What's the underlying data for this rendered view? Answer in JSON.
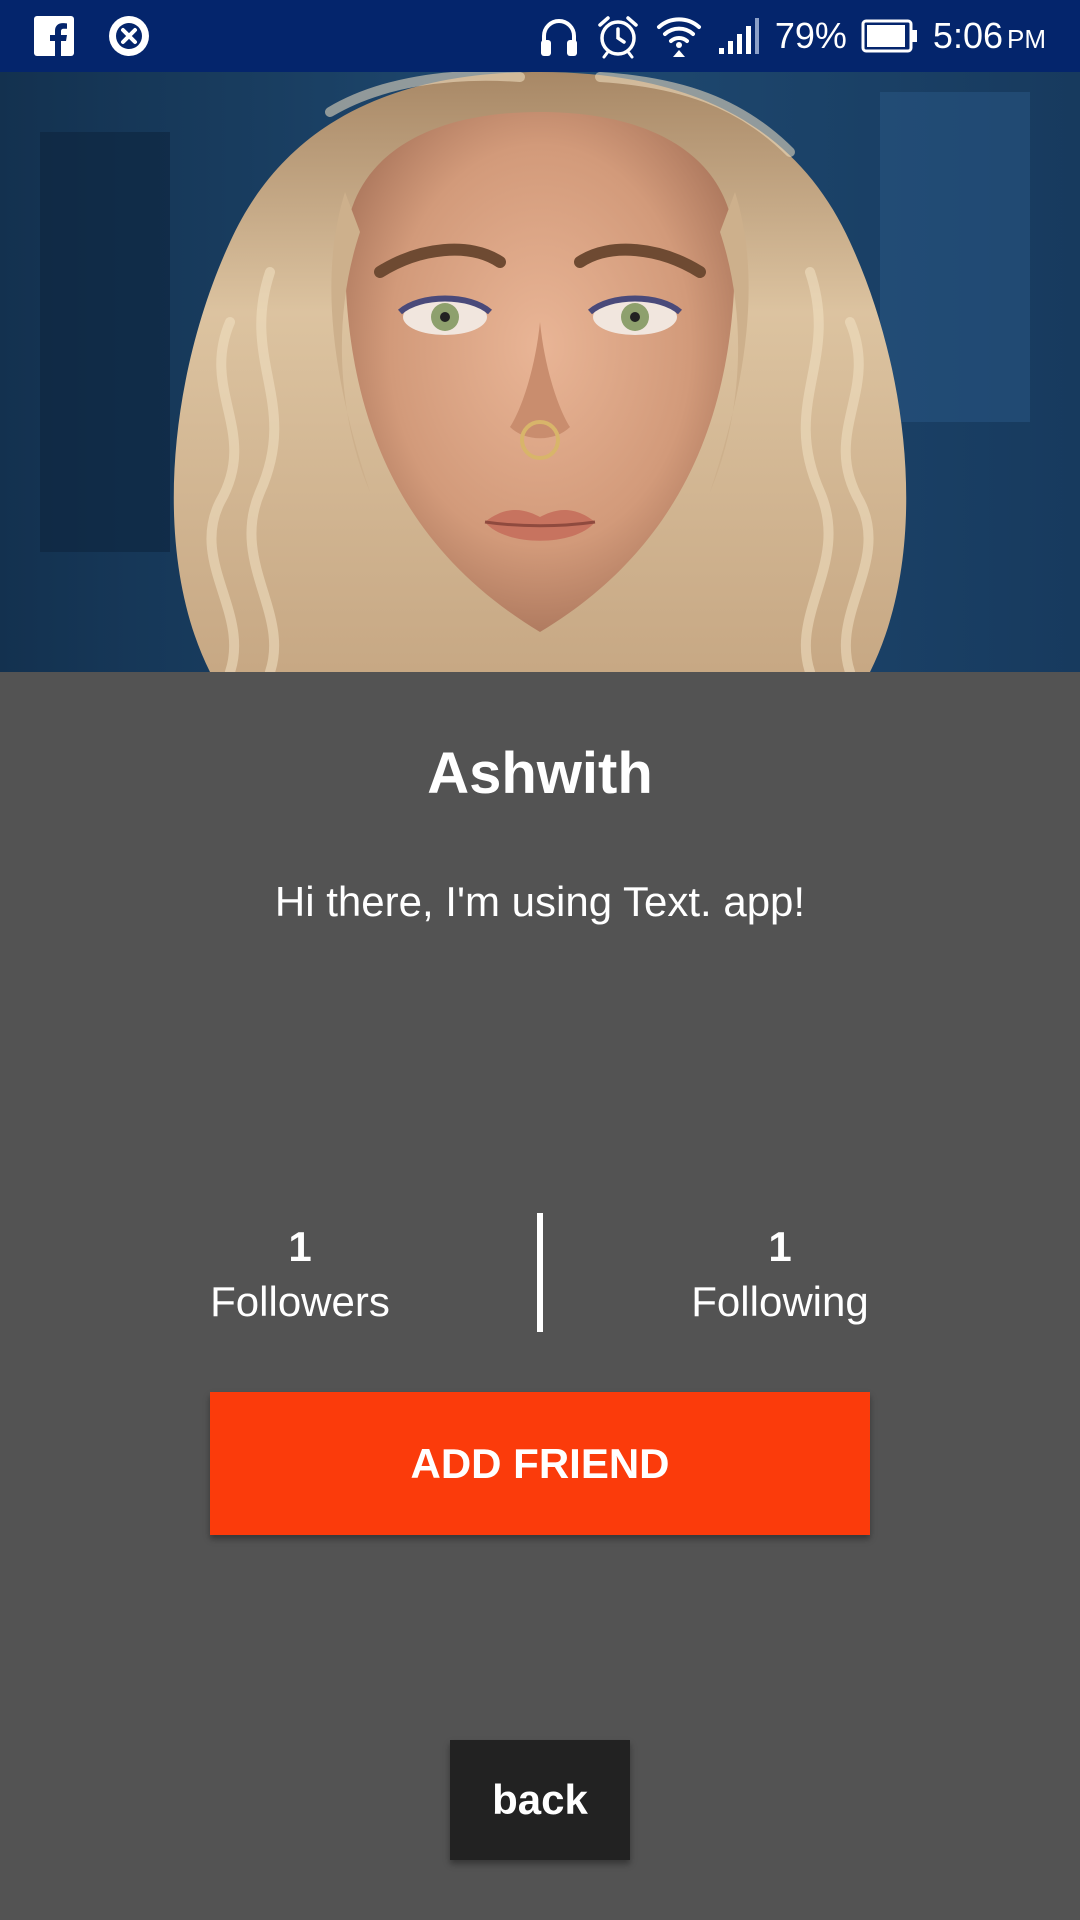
{
  "status_bar": {
    "battery_percent": "79%",
    "time": "5:06",
    "time_suffix": "PM",
    "left_icons": [
      "facebook-icon",
      "close-circle-icon"
    ],
    "right_icons": [
      "headphones-icon",
      "alarm-icon",
      "wifi-icon",
      "signal-icon",
      "battery-icon"
    ],
    "background_color": "#04256c"
  },
  "profile": {
    "photo": "profile-photo",
    "name": "Ashwith",
    "status_message": "Hi there, I'm using Text. app!"
  },
  "stats": {
    "followers": {
      "count": "1",
      "label": "Followers"
    },
    "following": {
      "count": "1",
      "label": "Following"
    }
  },
  "actions": {
    "add_friend_label": "ADD FRIEND",
    "back_label": "back"
  },
  "colors": {
    "page_background": "#535353",
    "accent": "#fb3b0b",
    "back_button": "#222222"
  }
}
